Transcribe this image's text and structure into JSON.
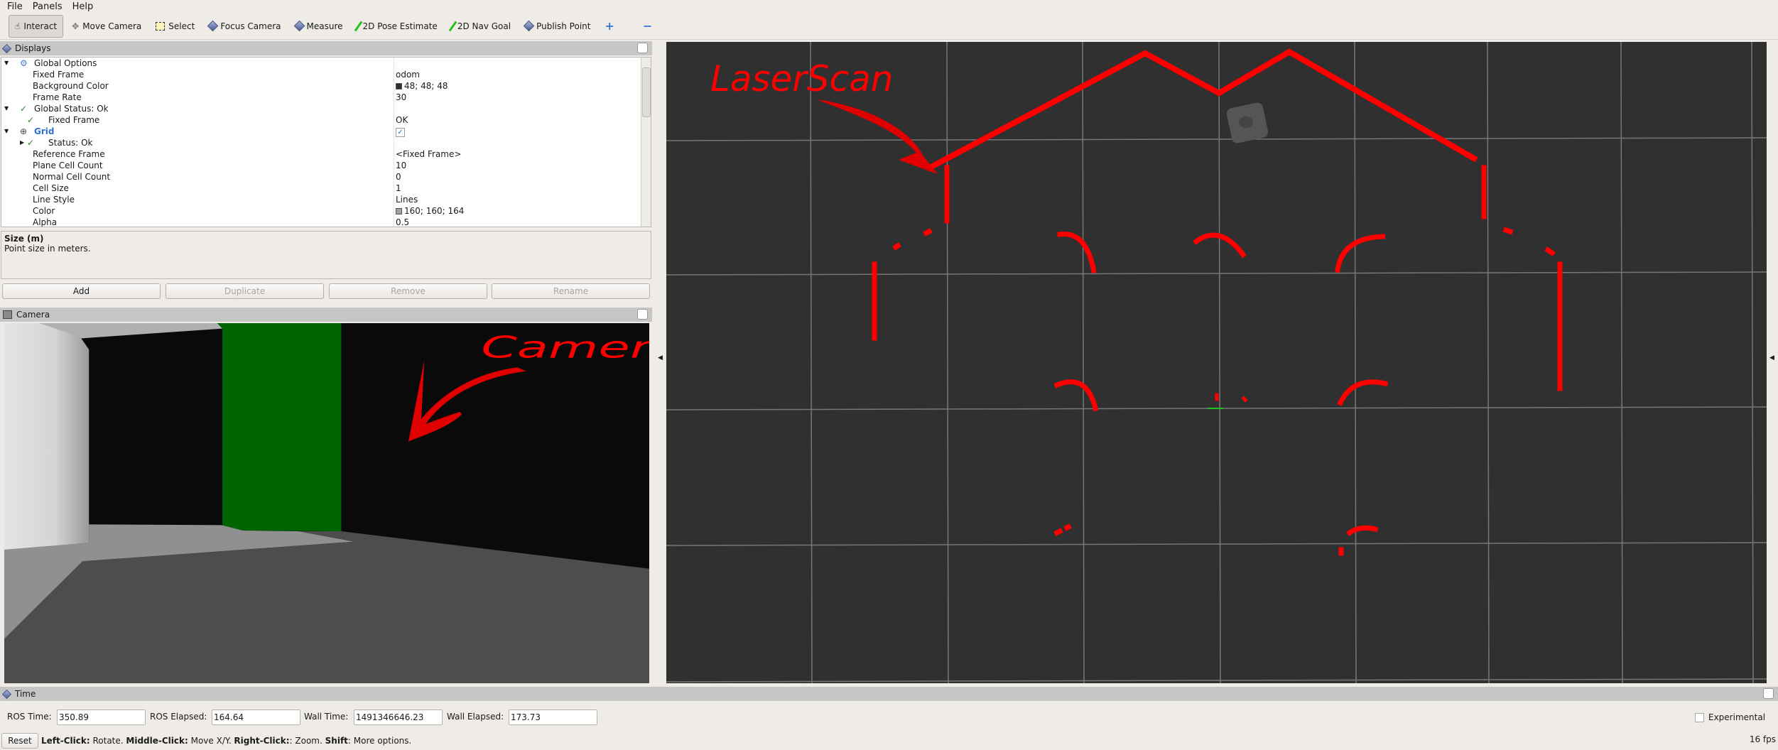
{
  "menu": [
    "File",
    "Panels",
    "Help"
  ],
  "toolbar": [
    {
      "label": "Interact",
      "icon": "hand-icon",
      "active": true
    },
    {
      "label": "Move Camera",
      "icon": "move-camera-icon"
    },
    {
      "label": "Select",
      "icon": "select-icon"
    },
    {
      "label": "Focus Camera",
      "icon": "diamond-icon"
    },
    {
      "label": "Measure",
      "icon": "diamond-icon"
    },
    {
      "label": "2D Pose Estimate",
      "icon": "green-arrow-icon"
    },
    {
      "label": "2D Nav Goal",
      "icon": "green-arrow-icon"
    },
    {
      "label": "Publish Point",
      "icon": "diamond-icon"
    }
  ],
  "displays": {
    "title": "Displays",
    "rows": [
      {
        "label": "Global Options",
        "value": "",
        "level": 0,
        "expander": "down",
        "icon": "gear-icon"
      },
      {
        "label": "Fixed Frame",
        "value": "odom",
        "level": 1
      },
      {
        "label": "Background Color",
        "value": "48; 48; 48",
        "level": 1,
        "swatch": "#303030"
      },
      {
        "label": "Frame Rate",
        "value": "30",
        "level": 1
      },
      {
        "label": "Global Status: Ok",
        "value": "",
        "level": 0,
        "expander": "down",
        "icon": "check-icon"
      },
      {
        "label": "Fixed Frame",
        "value": "OK",
        "level": 2,
        "icon": "check-icon"
      },
      {
        "label": "Grid",
        "value": "✓",
        "level": 0,
        "expander": "down",
        "icon": "grid-icon",
        "highlight": true,
        "checkbox": true
      },
      {
        "label": "Status: Ok",
        "value": "",
        "level": 2,
        "expander": "right",
        "icon": "check-icon"
      },
      {
        "label": "Reference Frame",
        "value": "<Fixed Frame>",
        "level": 1
      },
      {
        "label": "Plane Cell Count",
        "value": "10",
        "level": 1
      },
      {
        "label": "Normal Cell Count",
        "value": "0",
        "level": 1
      },
      {
        "label": "Cell Size",
        "value": "1",
        "level": 1
      },
      {
        "label": "Line Style",
        "value": "Lines",
        "level": 1
      },
      {
        "label": "Color",
        "value": "160; 160; 164",
        "level": 1,
        "swatch": "#a0a0a4"
      },
      {
        "label": "Alpha",
        "value": "0.5",
        "level": 1
      }
    ],
    "description_title": "Size (m)",
    "description_text": "Point size in meters.",
    "buttons": {
      "add": "Add",
      "duplicate": "Duplicate",
      "remove": "Remove",
      "rename": "Rename"
    }
  },
  "camera_panel": {
    "title": "Camera"
  },
  "annotations": {
    "camera": "Camera",
    "laserscan": "LaserScan",
    "color": "#ff0000"
  },
  "time": {
    "title": "Time",
    "ros_time_label": "ROS Time:",
    "ros_time": "350.89",
    "ros_elapsed_label": "ROS Elapsed:",
    "ros_elapsed": "164.64",
    "wall_time_label": "Wall Time:",
    "wall_time": "1491346646.23",
    "wall_elapsed_label": "Wall Elapsed:",
    "wall_elapsed": "173.73",
    "experimental": "Experimental"
  },
  "status": {
    "reset": "Reset",
    "hint": [
      {
        "b": "Left-Click:",
        "t": " Rotate. "
      },
      {
        "b": "Middle-Click:",
        "t": " Move X/Y. "
      },
      {
        "b": "Right-Click:",
        "t": ": Zoom. "
      },
      {
        "b": "Shift",
        "t": ": More options."
      }
    ],
    "fps": "16 fps"
  },
  "colors": {
    "view_background": "#303030",
    "grid": "#a0a0a4",
    "laser": "#ff0000",
    "panel_header": "#c6c6c6"
  }
}
